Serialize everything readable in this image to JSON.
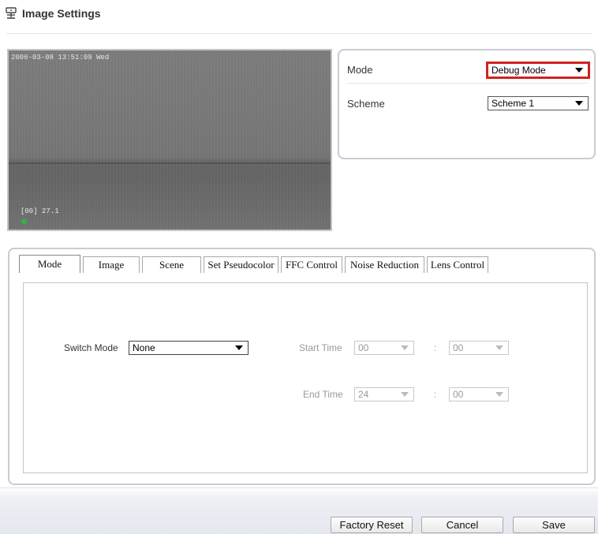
{
  "header": {
    "title": "Image Settings",
    "icon": "camera-settings-icon"
  },
  "video": {
    "timestamp": "2006-03-08 13:51:09 Wed",
    "temperature": "[00] 27.1",
    "crosshair": "✱"
  },
  "mode_box": {
    "mode_label": "Mode",
    "mode_value": "Debug Mode",
    "scheme_label": "Scheme",
    "scheme_value": "Scheme 1"
  },
  "tabs": [
    {
      "label": "Mode",
      "active": true
    },
    {
      "label": "Image",
      "active": false
    },
    {
      "label": "Scene",
      "active": false
    },
    {
      "label": "Set Pseudocolor",
      "active": false
    },
    {
      "label": "FFC Control",
      "active": false
    },
    {
      "label": "Noise Reduction",
      "active": false
    },
    {
      "label": "Lens Control",
      "active": false
    }
  ],
  "mode_tab": {
    "switch_mode_label": "Switch Mode",
    "switch_mode_value": "None",
    "start_time_label": "Start Time",
    "start_hour": "00",
    "start_minute": "00",
    "end_time_label": "End Time",
    "end_hour": "24",
    "end_minute": "00",
    "separator": ":"
  },
  "footer": {
    "factory_reset_label": "Factory Reset",
    "cancel_label": "Cancel",
    "save_label": "Save"
  },
  "colors": {
    "highlight_border": "#d1221f",
    "panel_border": "#c9ccd3"
  }
}
